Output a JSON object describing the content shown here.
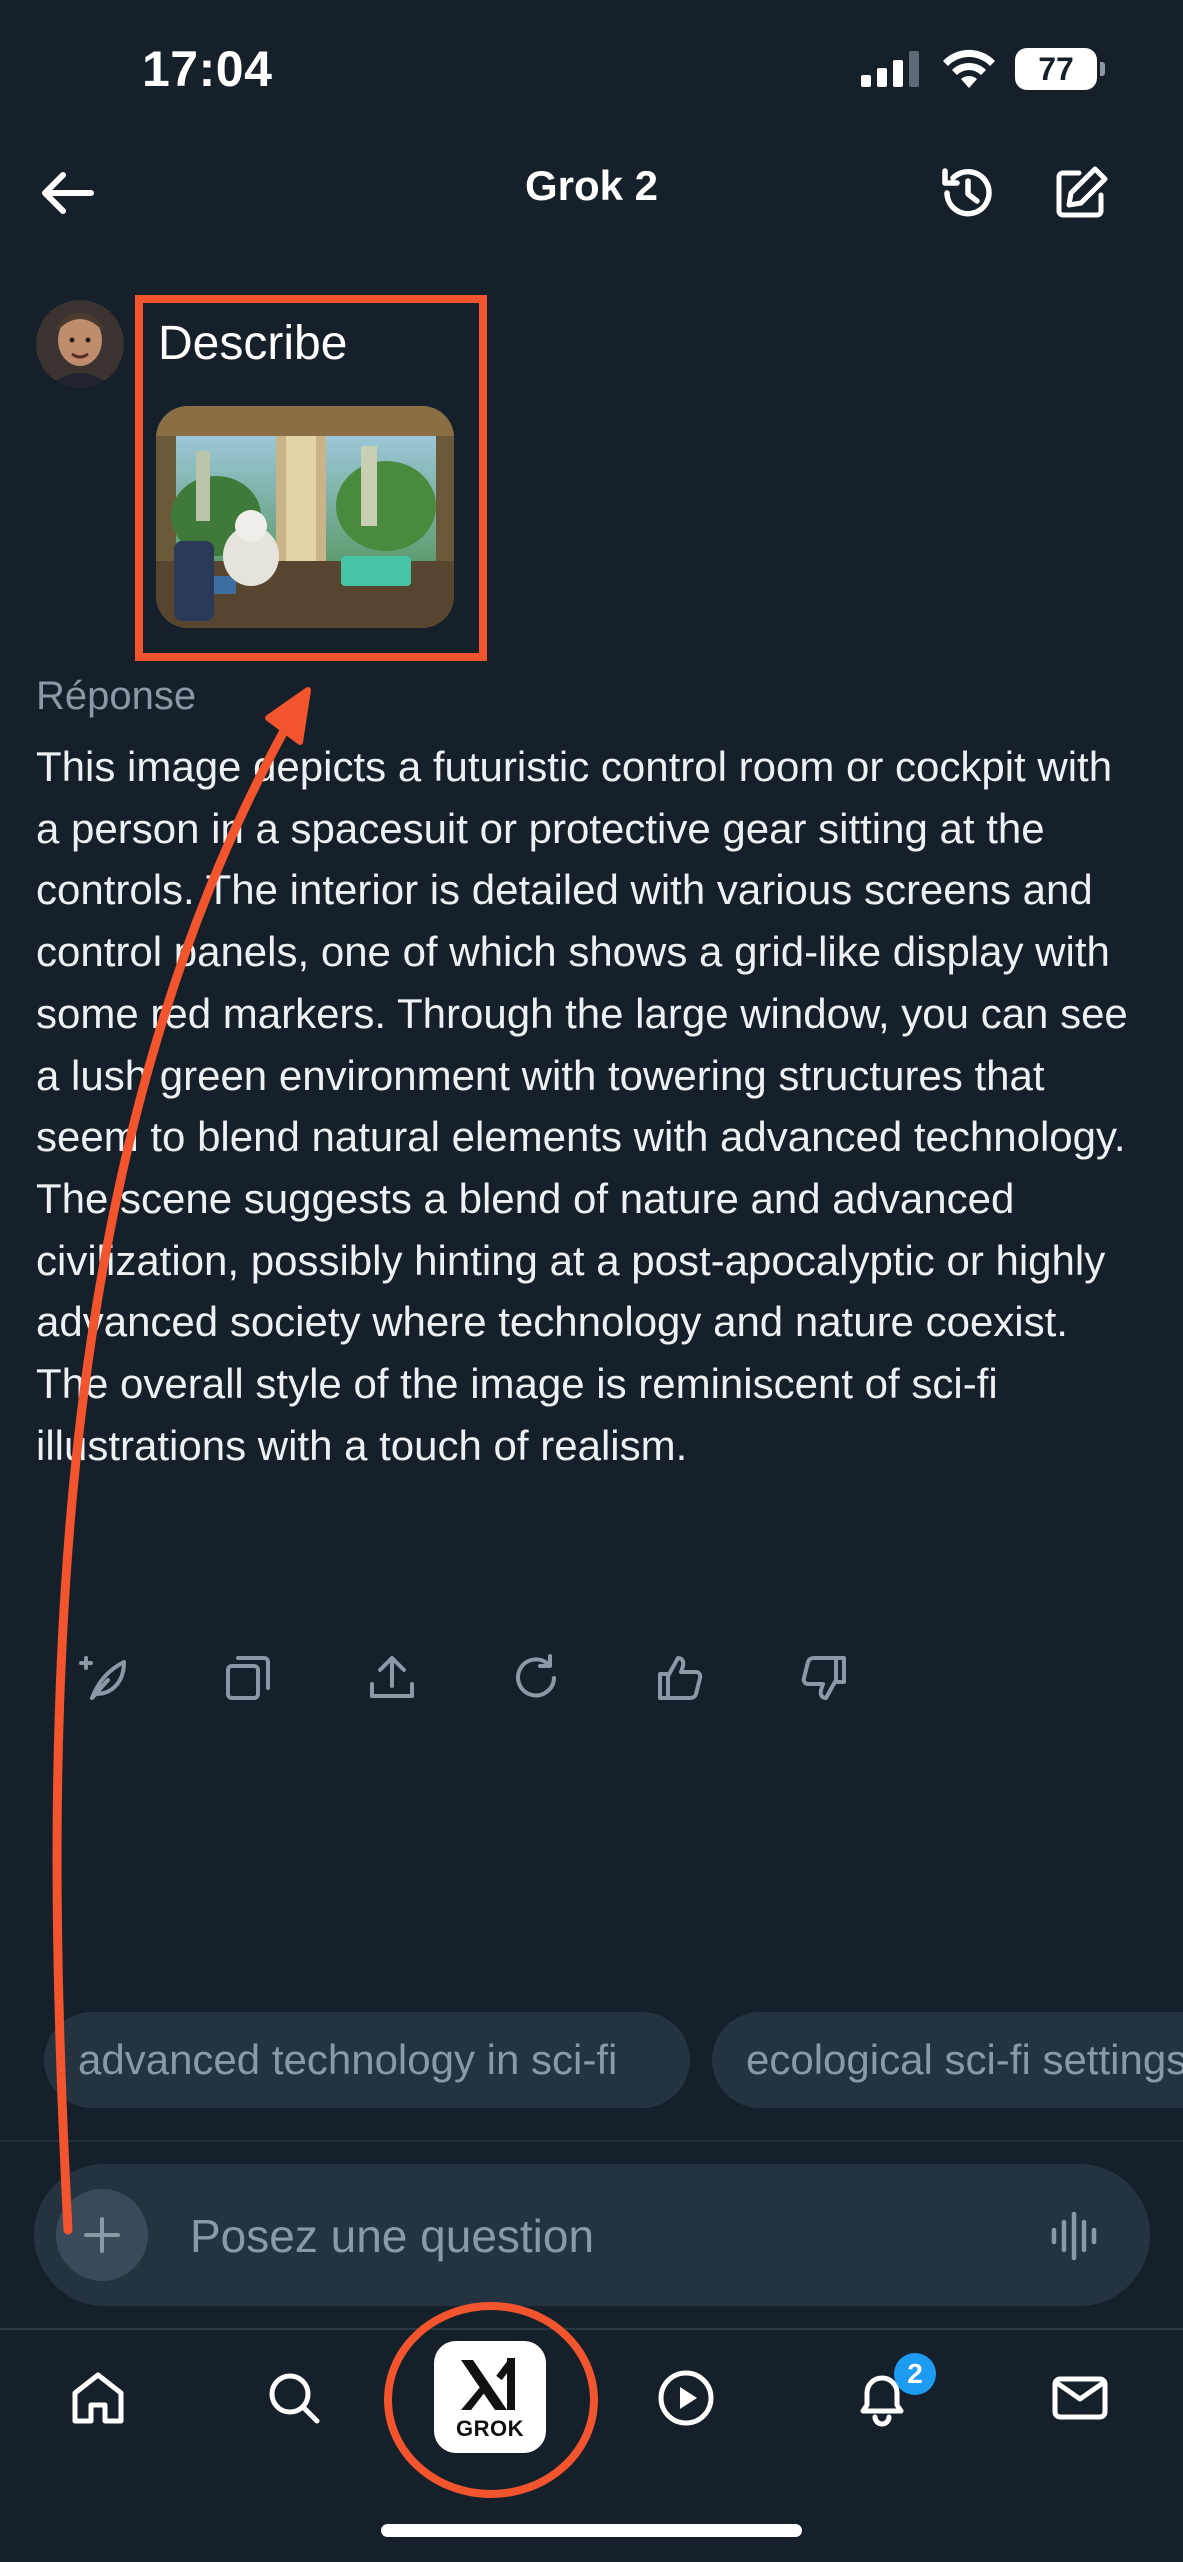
{
  "status_bar": {
    "time": "17:04",
    "battery": "77",
    "icons": [
      "signal-icon",
      "wifi-icon",
      "battery-icon"
    ]
  },
  "header": {
    "title": "Grok 2",
    "back_icon": "arrow-left-icon",
    "history_icon": "history-icon",
    "compose_icon": "compose-icon"
  },
  "message": {
    "prompt": "Describe",
    "response_label": "Réponse",
    "response_text": "This image depicts a futuristic control room or cockpit with a person in a spacesuit or protective gear sitting at the controls. The interior is detailed with various screens and control panels, one of which shows a grid-like display with some red markers. Through the large window, you can see a lush green environment with towering structures that seem to blend natural elements with advanced technology. The scene suggests a blend of nature and advanced civilization, possibly hinting at a post-apocalyptic or highly advanced society where technology and nature coexist. The overall style of the image is reminiscent of sci-fi illustrations with a touch of realism."
  },
  "response_actions": [
    "regenerate-sparkle-icon",
    "copy-icon",
    "share-icon",
    "refresh-icon",
    "thumbs-up-icon",
    "thumbs-down-icon"
  ],
  "suggestions": [
    "advanced technology in sci-fi",
    "ecological sci-fi settings"
  ],
  "input": {
    "placeholder": "Posez une question"
  },
  "bottom_nav": {
    "grok_label": "GROK",
    "notification_count": "2",
    "items": [
      "home-icon",
      "search-icon",
      "grok-icon",
      "play-icon",
      "bell-icon",
      "mail-icon"
    ]
  },
  "annotations": {
    "highlight_color": "#f2542d"
  }
}
